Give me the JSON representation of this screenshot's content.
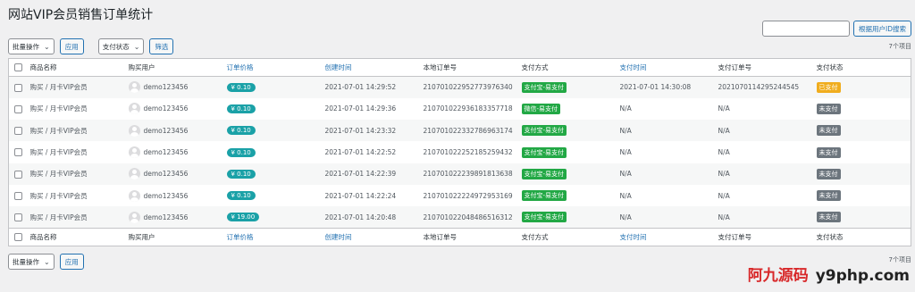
{
  "page": {
    "title": "网站VIP会员销售订单统计",
    "search_placeholder": "",
    "search_button": "根据用户ID搜索",
    "item_count": "7个项目"
  },
  "toolbar": {
    "bulk_action": "批量操作",
    "apply": "应用",
    "pay_status_filter": "支付状态",
    "filter": "筛选"
  },
  "columns": [
    "商品名称",
    "购买用户",
    "订单价格",
    "创建时间",
    "本地订单号",
    "支付方式",
    "支付时间",
    "支付订单号",
    "支付状态"
  ],
  "rows": [
    {
      "product": "购买 / 月卡VIP会员",
      "user": "demo123456",
      "price": "¥ 0.10",
      "created": "2021-07-01 14:29:52",
      "local_order": "210701022952773976340",
      "method": "支付宝-易支付",
      "paid_time": "2021-07-01 14:30:08",
      "pay_order": "2021070114295244545",
      "status": "已支付"
    },
    {
      "product": "购买 / 月卡VIP会员",
      "user": "demo123456",
      "price": "¥ 0.10",
      "created": "2021-07-01 14:29:36",
      "local_order": "210701022936183357718",
      "method": "微信-易支付",
      "paid_time": "N/A",
      "pay_order": "N/A",
      "status": "未支付"
    },
    {
      "product": "购买 / 月卡VIP会员",
      "user": "demo123456",
      "price": "¥ 0.10",
      "created": "2021-07-01 14:23:32",
      "local_order": "210701022332786963174",
      "method": "支付宝-易支付",
      "paid_time": "N/A",
      "pay_order": "N/A",
      "status": "未支付"
    },
    {
      "product": "购买 / 月卡VIP会员",
      "user": "demo123456",
      "price": "¥ 0.10",
      "created": "2021-07-01 14:22:52",
      "local_order": "210701022252185259432",
      "method": "支付宝-易支付",
      "paid_time": "N/A",
      "pay_order": "N/A",
      "status": "未支付"
    },
    {
      "product": "购买 / 月卡VIP会员",
      "user": "demo123456",
      "price": "¥ 0.10",
      "created": "2021-07-01 14:22:39",
      "local_order": "210701022239891813638",
      "method": "支付宝-易支付",
      "paid_time": "N/A",
      "pay_order": "N/A",
      "status": "未支付"
    },
    {
      "product": "购买 / 月卡VIP会员",
      "user": "demo123456",
      "price": "¥ 0.10",
      "created": "2021-07-01 14:22:24",
      "local_order": "210701022224972953169",
      "method": "支付宝-易支付",
      "paid_time": "N/A",
      "pay_order": "N/A",
      "status": "未支付"
    },
    {
      "product": "购买 / 月卡VIP会员",
      "user": "demo123456",
      "price": "¥ 19.00",
      "created": "2021-07-01 14:20:48",
      "local_order": "210701022048486516312",
      "method": "支付宝-易支付",
      "paid_time": "N/A",
      "pay_order": "N/A",
      "status": "未支付"
    }
  ],
  "watermark": {
    "cn": "阿九源码",
    "en": "y9php.com"
  }
}
